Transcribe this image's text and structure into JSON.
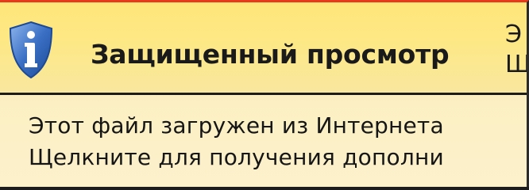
{
  "banner": {
    "title": "Защищенный просмотр",
    "right_line1": "Э",
    "right_line2": "Щ",
    "icon": "info-shield-icon"
  },
  "message": {
    "line1": "Этот файл загружен из Интернета",
    "line2": "Щелкните для получения дополни"
  },
  "colors": {
    "banner_bg": "#ffe679",
    "shield": "#3a6fc4",
    "top_border": "#e8391f"
  }
}
